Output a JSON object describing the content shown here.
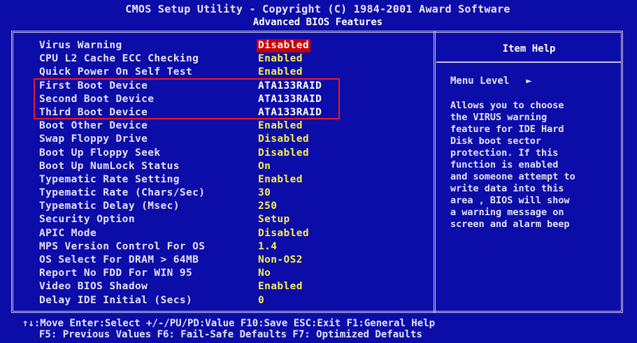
{
  "header": {
    "title": "CMOS Setup Utility - Copyright (C) 1984-2001 Award Software",
    "subtitle": "Advanced BIOS Features"
  },
  "settings": [
    {
      "label": "Virus Warning",
      "value": "Disabled"
    },
    {
      "label": "CPU L2 Cache ECC Checking",
      "value": "Enabled"
    },
    {
      "label": "Quick Power On Self Test",
      "value": "Enabled"
    },
    {
      "label": "First Boot Device",
      "value": "ATA133RAID"
    },
    {
      "label": "Second Boot Device",
      "value": "ATA133RAID"
    },
    {
      "label": "Third Boot Device",
      "value": "ATA133RAID"
    },
    {
      "label": "Boot Other Device",
      "value": "Enabled"
    },
    {
      "label": "Swap Floppy Drive",
      "value": "Disabled"
    },
    {
      "label": "Boot Up Floppy Seek",
      "value": "Disabled"
    },
    {
      "label": "Boot Up NumLock Status",
      "value": "On"
    },
    {
      "label": "Typematic Rate Setting",
      "value": "Enabled"
    },
    {
      "label": "Typematic Rate (Chars/Sec)",
      "value": "30"
    },
    {
      "label": "Typematic Delay (Msec)",
      "value": "250"
    },
    {
      "label": "Security Option",
      "value": "Setup"
    },
    {
      "label": "APIC Mode",
      "value": "Disabled"
    },
    {
      "label": "MPS Version Control For OS",
      "value": "1.4"
    },
    {
      "label": "OS Select For DRAM > 64MB",
      "value": "Non-OS2"
    },
    {
      "label": "Report No FDD For WIN 95",
      "value": "No"
    },
    {
      "label": "Video BIOS Shadow",
      "value": "Enabled"
    },
    {
      "label": "Delay IDE Initial (Secs)",
      "value": "0"
    }
  ],
  "help": {
    "title": "Item Help",
    "menu_level_label": "Menu Level",
    "menu_level_arrow": "►",
    "text": "Allows you to choose\nthe VIRUS warning\nfeature for IDE Hard\nDisk boot sector\nprotection. If this\nfunction is enabled\nand someone attempt to\nwrite data into this\narea , BIOS will show\na warning message on\nscreen and alarm beep"
  },
  "footer": {
    "line1": "↑↓:Move  Enter:Select  +/-/PU/PD:Value  F10:Save  ESC:Exit  F1:General Help",
    "line2": "F5: Previous Values    F6: Fail-Safe Defaults      F7: Optimized Defaults"
  },
  "colors": {
    "background": "#0c0ca8",
    "value_text": "#f8f050",
    "selected_bg": "#c80000",
    "highlight_box": "#ee1a28"
  }
}
